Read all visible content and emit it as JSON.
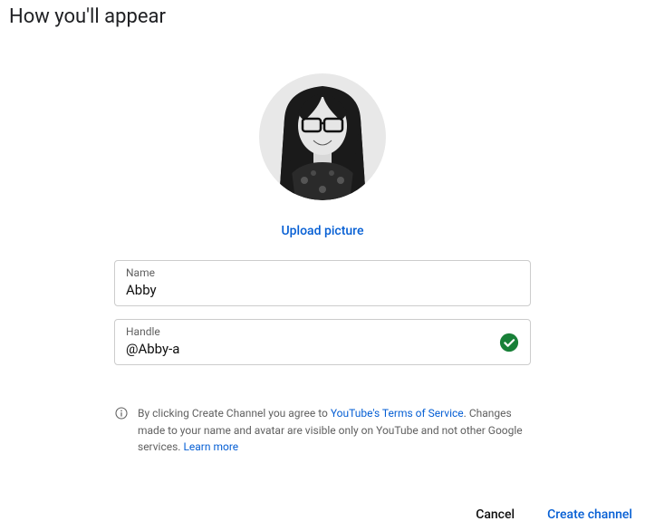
{
  "title": "How you'll appear",
  "upload_label": "Upload picture",
  "fields": {
    "name": {
      "label": "Name",
      "value": "Abby"
    },
    "handle": {
      "label": "Handle",
      "value": "@Abby-a",
      "valid": true
    }
  },
  "disclaimer": {
    "prefix": "By clicking Create Channel you agree to ",
    "tos_link": "YouTube's Terms of Service",
    "middle": ". Changes made to your name and avatar are visible only on YouTube and not other Google services. ",
    "learn_more": "Learn more"
  },
  "buttons": {
    "cancel": "Cancel",
    "create": "Create channel"
  }
}
